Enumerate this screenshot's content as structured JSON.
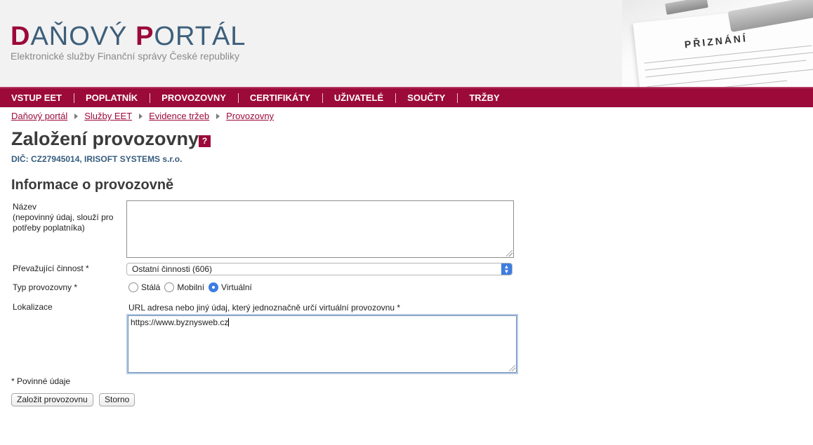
{
  "header": {
    "logo": {
      "d": "D",
      "ano": "AŇOVÝ ",
      "p": "P",
      "ortal": "ORTÁL"
    },
    "subtitle": "Elektronické služby Finanční správy České republiky",
    "art_title": "PŘIZNÁNÍ"
  },
  "nav": {
    "items": [
      {
        "label": "VSTUP EET"
      },
      {
        "label": "POPLATNÍK"
      },
      {
        "label": "PROVOZOVNY"
      },
      {
        "label": "CERTIFIKÁTY"
      },
      {
        "label": "UŽIVATELÉ"
      },
      {
        "label": "SOUČTY"
      },
      {
        "label": "TRŽBY"
      }
    ]
  },
  "breadcrumb": [
    "Daňový portál",
    "Služby EET",
    "Evidence tržeb",
    "Provozovny"
  ],
  "page": {
    "title": "Založení provozovny",
    "help": "?",
    "dic": "DIČ: CZ27945014, IRISOFT SYSTEMS s.r.o.",
    "section": "Informace o provozovně"
  },
  "form": {
    "name_label": "Název",
    "name_hint1": "(nepovinný údaj, slouží pro",
    "name_hint2": "potřeby poplatníka)",
    "name_value": "",
    "activity_label": "Převažující činnost *",
    "activity_value": "Ostatní činnosti (606)",
    "type_label": "Typ provozovny *",
    "type_options": [
      {
        "label": "Stálá",
        "checked": false
      },
      {
        "label": "Mobilní",
        "checked": false
      },
      {
        "label": "Virtuální",
        "checked": true
      }
    ],
    "location_label": "Lokalizace",
    "location_hint": "URL adresa nebo jiný údaj, který jednoznačně určí virtuální provozovnu *",
    "location_value": "https://www.byznysweb.cz",
    "required_note": "* Povinné údaje",
    "submit_label": "Založit provozovnu",
    "cancel_label": "Storno"
  },
  "colors": {
    "brand": "#9c0a3a",
    "accent": "#3d7ce2",
    "title": "#355c7d"
  }
}
